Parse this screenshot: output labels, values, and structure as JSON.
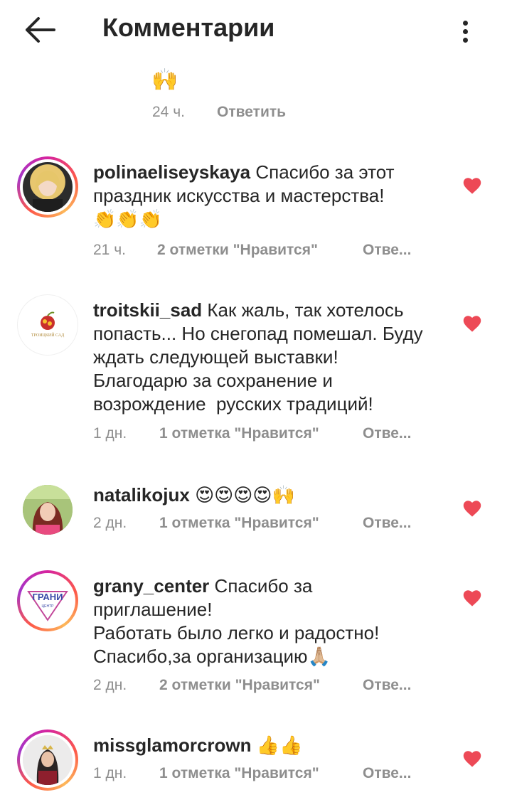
{
  "header": {
    "title": "Комментарии"
  },
  "reply_tail": {
    "emoji": "🙌",
    "time": "24 ч.",
    "reply_label": "Ответить"
  },
  "comments": [
    {
      "username": "polinaeliseyskaya",
      "text": "Спасибо за этот праздник искусства и мастерства!\n👏👏👏",
      "time": "21 ч.",
      "likes": "2 отметки \"Нравится\"",
      "reply": "Отве..."
    },
    {
      "username": "troitskii_sad",
      "text": "Как жаль, так хотелось попасть... Но снегопад помешал. Буду ждать следующей выставки! Благодарю за сохранение и возрождение  русских традиций!",
      "time": "1 дн.",
      "likes": "1 отметка \"Нравится\"",
      "reply": "Отве..."
    },
    {
      "username": "natalikojux",
      "text": "😍😍😍😍🙌",
      "time": "2 дн.",
      "likes": "1 отметка \"Нравится\"",
      "reply": "Отве..."
    },
    {
      "username": "grany_center",
      "text": "Спасибо за приглашение!\nРаботать было легко и радостно!\nСпасибо,за организацию🙏🏼",
      "time": "2 дн.",
      "likes": "2 отметки \"Нравится\"",
      "reply": "Отве..."
    },
    {
      "username": "missglamorcrown",
      "text": "👍👍",
      "time": "1 дн.",
      "likes": "1 отметка \"Нравится\"",
      "reply": "Отве..."
    }
  ],
  "logos": {
    "troitskii": "ТРОИЦКИЙ САД",
    "grany_main": "ГРАНИ",
    "grany_sub": "ЦЕНТР"
  },
  "colors": {
    "heart": "#ed4956",
    "meta": "#8e8e8e",
    "text": "#262626"
  }
}
